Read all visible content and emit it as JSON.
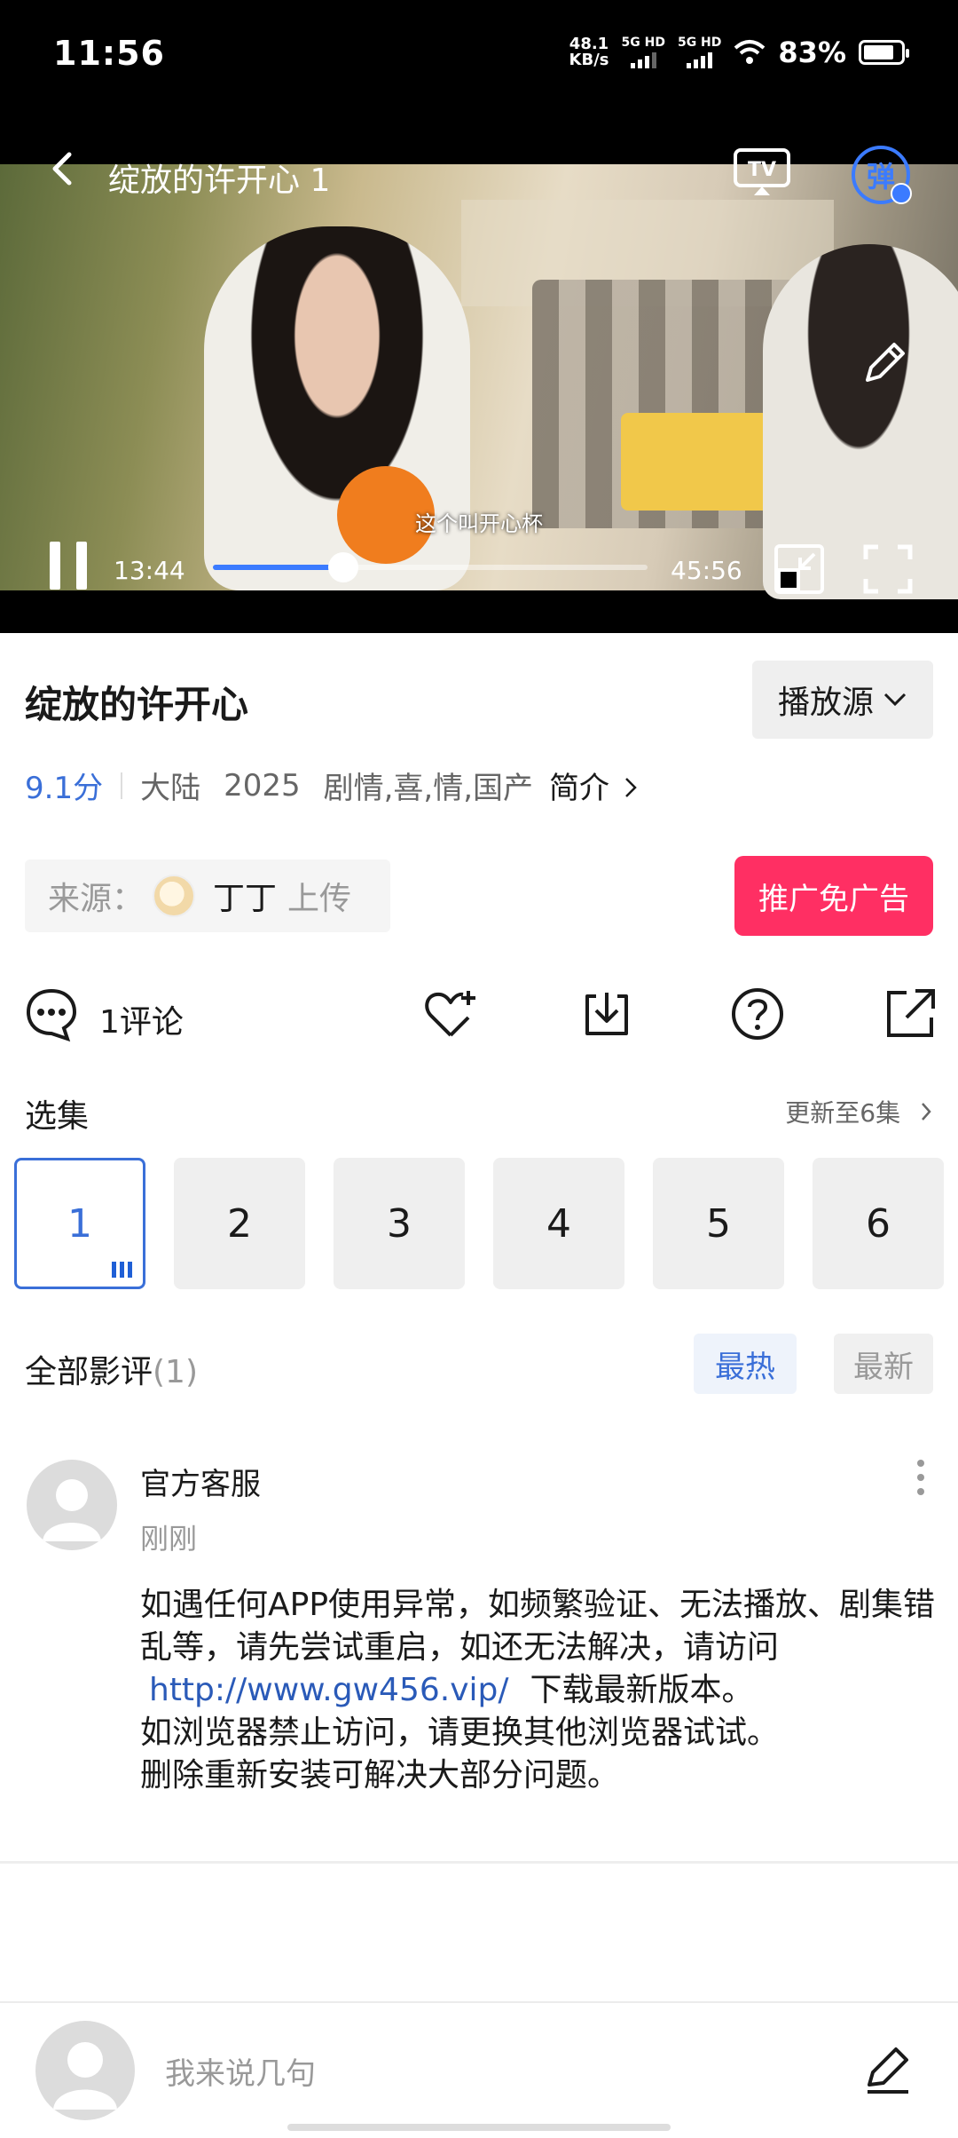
{
  "status_bar": {
    "time": "11:56",
    "speed": "48.1",
    "speed_unit": "KB/s",
    "sim1": "5G HD",
    "sim2": "5G HD",
    "battery": "83%",
    "battery_level": 0.83
  },
  "player": {
    "title": "绽放的许开心 1",
    "subtitle": "这个叫开心杯",
    "current_time": "13:44",
    "total_time": "45:56",
    "progress": 0.299,
    "danmu_label": "弹"
  },
  "info": {
    "title": "绽放的许开心",
    "source_button": "播放源",
    "score": "9.1分",
    "region": "大陆",
    "year": "2025",
    "genres": "剧情,喜,情,国产",
    "intro": "简介"
  },
  "uploader": {
    "prefix": "来源：",
    "name": "丁丁",
    "suffix": "上传",
    "promo_button": "推广免广告"
  },
  "actions": {
    "comment_count": "1评论"
  },
  "episodes": {
    "header": "选集",
    "update": "更新至6集",
    "items": [
      "1",
      "2",
      "3",
      "4",
      "5",
      "6"
    ],
    "active_index": 0
  },
  "reviews": {
    "header": "全部影评",
    "count": "(1)",
    "sort_hot": "最热",
    "sort_new": "最新",
    "items": [
      {
        "author": "官方客服",
        "time": "刚刚",
        "line1": "如遇任何APP使用异常，如频繁验证、无法播放、剧集错乱等，请先尝试重启，如还无法解决，请访问",
        "link": "http://www.gw456.vip/",
        "line2": "下载最新版本。",
        "line3": "如浏览器禁止访问，请更换其他浏览器试试。",
        "line4": "删除重新安装可解决大部分问题。"
      }
    ]
  },
  "bottom": {
    "placeholder": "我来说几句"
  }
}
